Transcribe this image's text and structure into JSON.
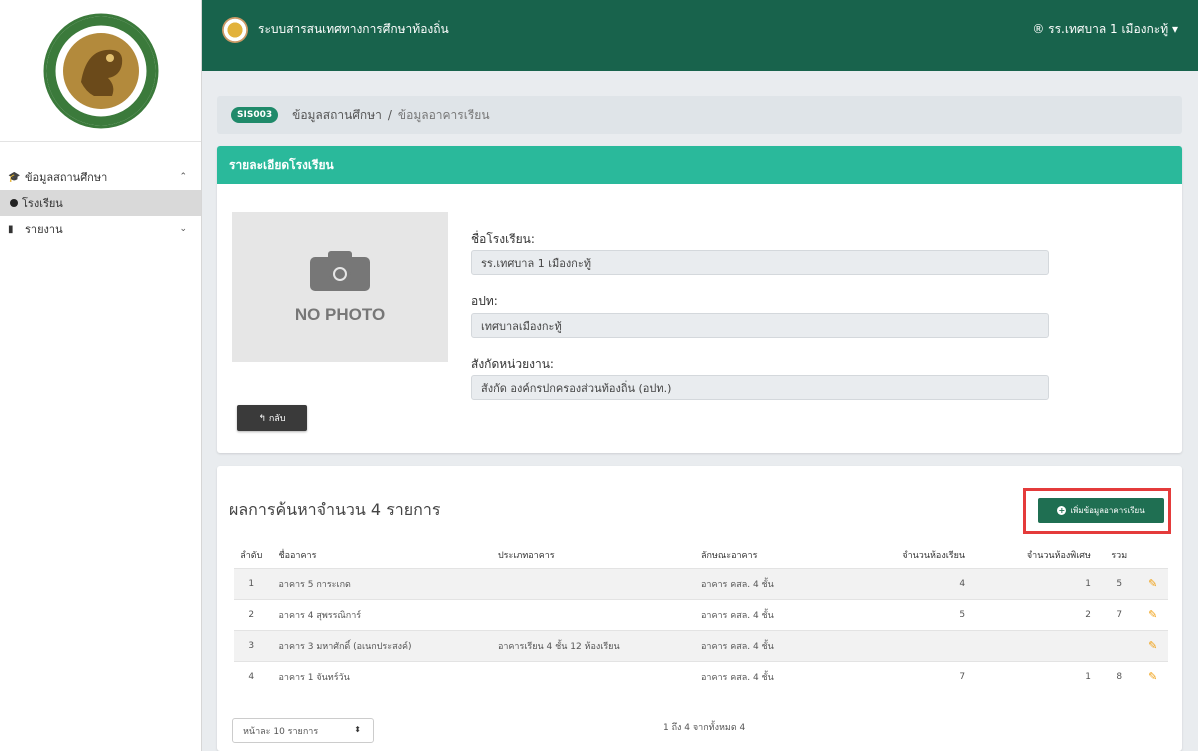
{
  "app": {
    "title": "ระบบสารสนเทศทางการศึกษาท้องถิ่น",
    "user": "® รร.เทศบาล 1 เมืองกะทู้ ▾"
  },
  "sidebar": {
    "items": [
      {
        "label": "ข้อมูลสถานศึกษา",
        "icon": "graduation-cap-icon"
      },
      {
        "label": "โรงเรียน",
        "icon": "dot-icon"
      },
      {
        "label": "รายงาน",
        "icon": "file-icon"
      }
    ]
  },
  "breadcrumb": {
    "badge": "SIS003",
    "current": "ข้อมูลสถานศึกษา",
    "separator": "/",
    "last": "ข้อมูลอาคารเรียน"
  },
  "detail": {
    "header": "รายละเอียดโรงเรียน",
    "no_photo": "NO PHOTO",
    "school_name_label": "ชื่อโรงเรียน:",
    "school_name": "รร.เทศบาล 1 เมืองกะทู้",
    "opt_label": "อปท:",
    "opt": "เทศบาลเมืองกะทู้",
    "affiliation_label": "สังกัดหน่วยงาน:",
    "affiliation": "สังกัด องค์กรปกครองส่วนท้องถิ่น (อปท.)",
    "back_label": "↰ กลับ"
  },
  "results": {
    "title": "ผลการค้นหาจำนวน 4 รายการ",
    "add_label": "เพิ่มข้อมูลอาคารเรียน",
    "columns": [
      "ลำดับ",
      "ชื่ออาคาร",
      "ประเภทอาคาร",
      "ลักษณะอาคาร",
      "จำนวนห้องเรียน",
      "จำนวนห้องพิเศษ",
      "รวม"
    ],
    "rows": [
      {
        "idx": "1",
        "name": "อาคาร 5 การะเกด",
        "type": "",
        "feature": "อาคาร คสล. 4 ชั้น",
        "classrooms": "4",
        "special": "1",
        "total": "5"
      },
      {
        "idx": "2",
        "name": "อาคาร 4 สุพรรณิการ์",
        "type": "",
        "feature": "อาคาร คสล. 4 ชั้น",
        "classrooms": "5",
        "special": "2",
        "total": "7"
      },
      {
        "idx": "3",
        "name": "อาคาร 3 มหาศักดิ์ (อเนกประสงค์)",
        "type": "อาคารเรียน 4 ชั้น 12 ห้องเรียน",
        "feature": "อาคาร คสล. 4 ชั้น",
        "classrooms": "",
        "special": "",
        "total": ""
      },
      {
        "idx": "4",
        "name": "อาคาร 1 จันทร์วัน",
        "type": "",
        "feature": "อาคาร คสล. 4 ชั้น",
        "classrooms": "7",
        "special": "1",
        "total": "8"
      }
    ],
    "page_size": "หน้าละ 10 รายการ",
    "page_info": "1 ถึง 4 จากทั้งหมด 4"
  }
}
